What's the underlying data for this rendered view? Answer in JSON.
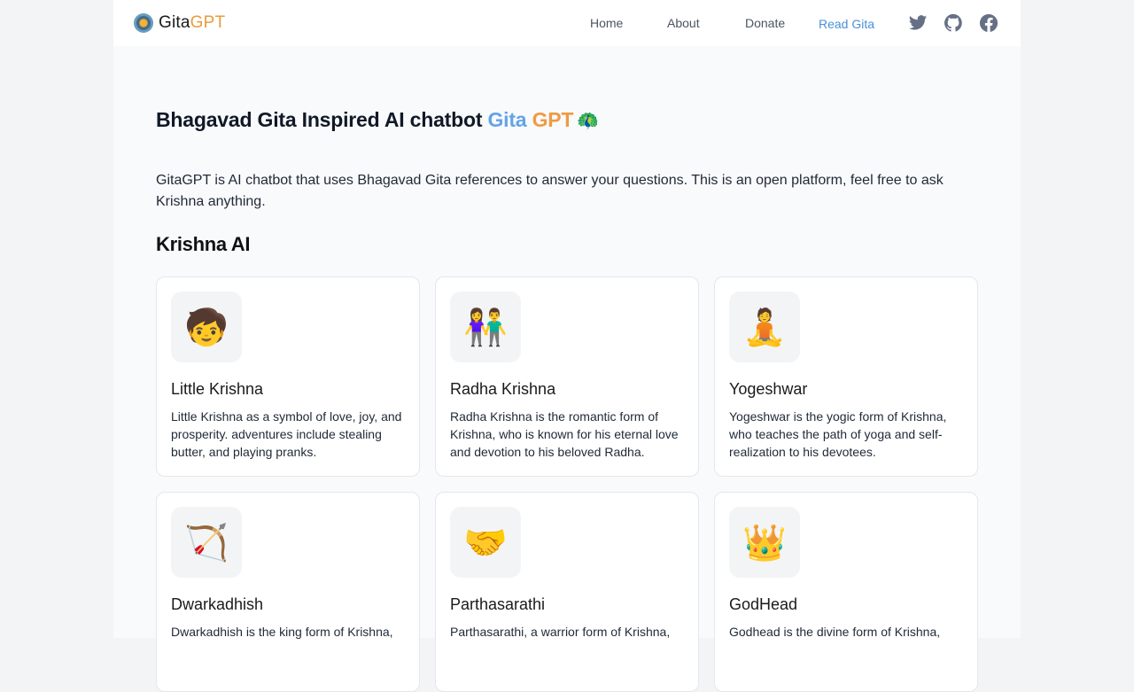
{
  "header": {
    "logo": {
      "prefix": "Gita",
      "suffix": "GPT",
      "icon": "mandala-logo-icon"
    },
    "nav": [
      {
        "label": "Home",
        "active": false
      },
      {
        "label": "About",
        "active": false
      },
      {
        "label": "Donate",
        "active": false
      },
      {
        "label": "Read Gita",
        "active": true
      }
    ],
    "social": [
      {
        "name": "twitter-icon"
      },
      {
        "name": "github-icon"
      },
      {
        "name": "facebook-icon"
      }
    ]
  },
  "hero": {
    "title_main": "Bhagavad Gita Inspired AI chatbot ",
    "title_gita": "Gita",
    "title_gpt": " GPT",
    "title_emoji": "🦚",
    "intro": "GitaGPT is AI chatbot that uses Bhagavad Gita references to answer your questions. This is an open platform, feel free to ask Krishna anything."
  },
  "section": {
    "title": "Krishna AI"
  },
  "cards": [
    {
      "title": "Little Krishna",
      "description": "Little Krishna as a symbol of love, joy, and prosperity. adventures include stealing butter, and playing pranks.",
      "icon": "little-krishna-illustration",
      "glyph": "🧒"
    },
    {
      "title": "Radha Krishna",
      "description": "Radha Krishna is the romantic form of Krishna, who is known for his eternal love and devotion to his beloved Radha.",
      "icon": "radha-krishna-illustration",
      "glyph": "👫"
    },
    {
      "title": "Yogeshwar",
      "description": "Yogeshwar is the yogic form of Krishna, who teaches the path of yoga and self-realization to his devotees.",
      "icon": "yogeshwar-illustration",
      "glyph": "🧘"
    },
    {
      "title": "Dwarkadhish",
      "description": "Dwarkadhish is the king form of Krishna,",
      "icon": "dwarkadhish-illustration",
      "glyph": "🏹"
    },
    {
      "title": "Parthasarathi",
      "description": "Parthasarathi, a warrior form of Krishna,",
      "icon": "parthasarathi-illustration",
      "glyph": "🤝"
    },
    {
      "title": "GodHead",
      "description": "Godhead is the divine form of Krishna,",
      "icon": "godhead-illustration",
      "glyph": "👑"
    }
  ]
}
